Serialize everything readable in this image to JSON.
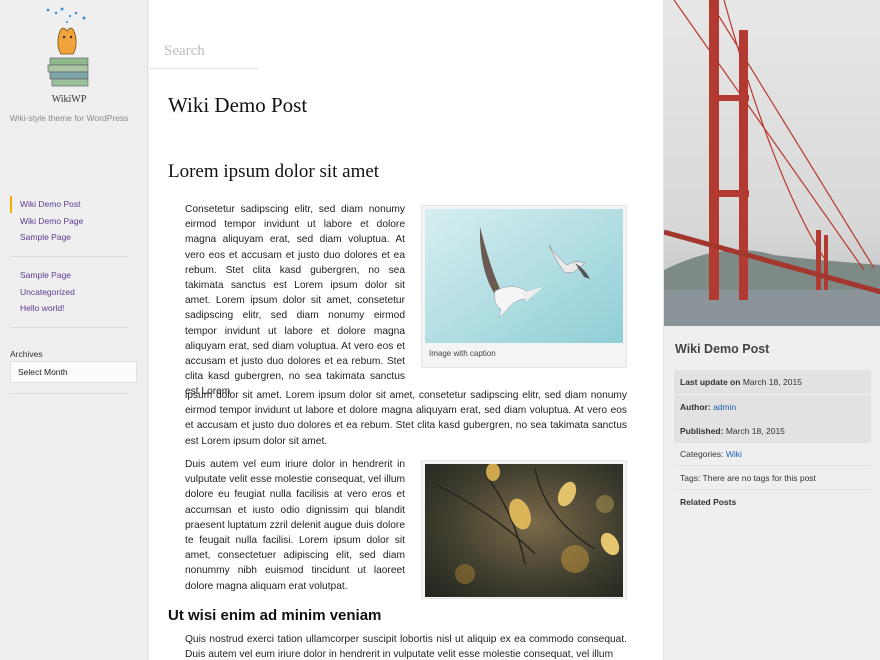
{
  "site": {
    "title": "WikiWP",
    "tagline": "Wiki-style theme for WordPress"
  },
  "nav_primary": [
    {
      "label": "Wiki Demo Post",
      "current": true
    },
    {
      "label": "Wiki Demo Page"
    },
    {
      "label": "Sample Page"
    }
  ],
  "nav_secondary": [
    {
      "label": "Sample Page"
    },
    {
      "label": "Uncategorized"
    },
    {
      "label": "Hello world!"
    }
  ],
  "archives": {
    "label": "Archives",
    "selected": "Select Month"
  },
  "search": {
    "placeholder": "Search"
  },
  "post": {
    "title": "Wiki Demo Post",
    "heading": "Lorem ipsum dolor sit amet",
    "p1": "Consetetur sadipscing elitr, sed diam nonumy eirmod tempor invidunt ut labore et dolore magna aliquyam erat, sed diam voluptua. At vero eos et accusam et justo duo dolores et ea rebum. Stet clita kasd gubergren, no sea takimata sanctus est Lorem ipsum dolor sit amet. Lorem ipsum dolor sit amet, consetetur sadipscing elitr, sed diam nonumy eirmod tempor invidunt ut labore et dolore magna aliquyam erat, sed diam voluptua. At vero eos et accusam et justo duo dolores et ea rebum. Stet clita kasd gubergren, no sea takimata sanctus est Lorem",
    "p2": "ipsum dolor sit amet. Lorem ipsum dolor sit amet, consetetur sadipscing elitr, sed diam nonumy eirmod tempor invidunt ut labore et dolore magna aliquyam erat, sed diam voluptua. At vero eos et accusam et justo duo dolores et ea rebum. Stet clita kasd gubergren, no sea takimata sanctus est Lorem ipsum dolor sit amet.",
    "image1_caption": "Image with caption",
    "p3": "Duis autem vel eum iriure dolor in hendrerit in vulputate velit esse molestie consequat, vel illum dolore eu feugiat nulla facilisis at vero eros et accumsan et iusto odio dignissim qui blandit praesent luptatum zzril delenit augue duis dolore te feugait nulla facilisi. Lorem ipsum dolor sit amet, consectetuer adipiscing elit, sed diam nonummy nibh euismod tincidunt ut laoreet dolore magna aliquam erat volutpat.",
    "subheading": "Ut wisi enim ad minim veniam",
    "p4": "Quis nostrud exerci tation ullamcorper suscipit lobortis nisl ut aliquip ex ea commodo consequat. Duis autem vel eum iriure dolor in hendrerit in vulputate velit esse molestie consequat, vel illum"
  },
  "sidebar_right": {
    "title": "Wiki Demo Post",
    "last_update_label": "Last update on",
    "last_update_value": "March 18, 2015",
    "author_label": "Author:",
    "author_value": "admin",
    "published_label": "Published:",
    "published_value": "March 18, 2015",
    "categories_label": "Categories:",
    "categories_value": "Wiki",
    "tags_text": "Tags: There are no tags for this post",
    "related_label": "Related Posts"
  },
  "colors": {
    "link": "#5b3a92",
    "meta_link": "#1a5fb4",
    "nav_indicator": "#f2a900"
  }
}
